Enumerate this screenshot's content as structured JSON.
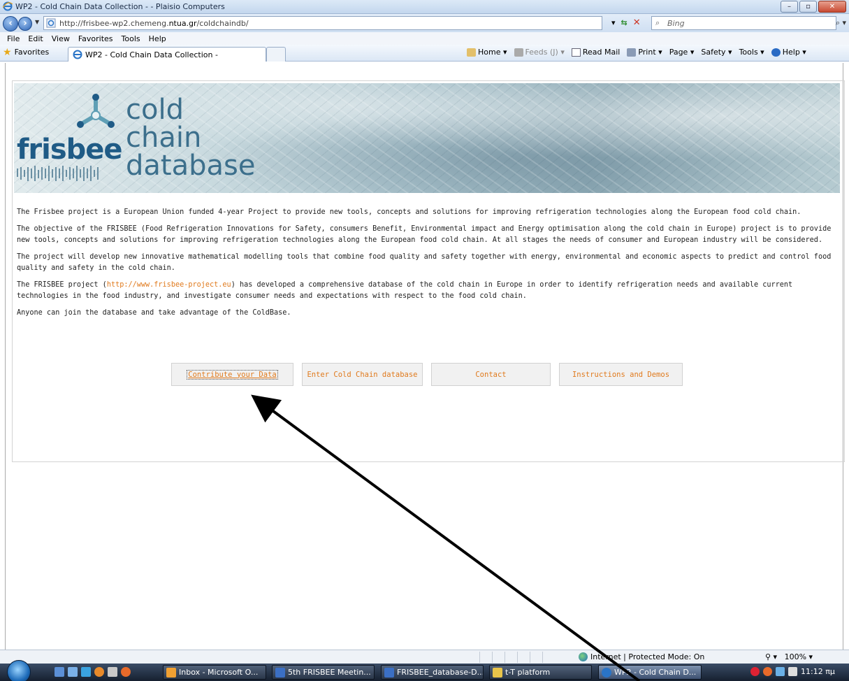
{
  "window": {
    "title": "WP2 - Cold Chain Data Collection - - Plaisio Computers",
    "minimize": "–",
    "maximize": "▫",
    "close": "✕"
  },
  "address_bar": {
    "url_prefix": "http://frisbee-wp2.chemeng.",
    "url_domain": "ntua.gr",
    "url_suffix": "/coldchaindb/",
    "search_placeholder": "Bing"
  },
  "menu": [
    "File",
    "Edit",
    "View",
    "Favorites",
    "Tools",
    "Help"
  ],
  "command_bar": {
    "favorites_label": "Favorites",
    "tab_title": "WP2 - Cold Chain Data Collection -",
    "home": "Home",
    "feeds": "Feeds (J)",
    "read_mail": "Read Mail",
    "print": "Print",
    "page": "Page",
    "safety": "Safety",
    "tools": "Tools",
    "help": "Help"
  },
  "banner": {
    "brand": "frisbee",
    "line1": "cold",
    "line2": "chain",
    "line3": "database"
  },
  "intro": {
    "p1": "The Frisbee project is a European Union funded 4-year Project to provide new tools, concepts and solutions for improving refrigeration technologies along the European food cold chain.",
    "p2": "The objective of the FRISBEE (Food Refrigeration Innovations for Safety, consumers Benefit, Environmental impact and Energy optimisation along the cold chain in Europe) project is to provide new tools, concepts and solutions for improving refrigeration technologies along the European food cold chain. At all stages the needs of consumer and European industry will be considered.",
    "p3": "The project will develop new innovative mathematical modelling tools that combine food quality and safety together with energy, environmental and economic aspects to predict and control food quality and safety in the cold chain.",
    "p4_before": "The FRISBEE project (",
    "p4_link": "http://www.frisbee-project.eu",
    "p4_after": ") has developed a comprehensive database of the cold chain in Europe in order to identify refrigeration needs and available current technologies in the food industry, and investigate consumer needs and expectations with respect to the food cold chain.",
    "p5": "Anyone can join the database and take advantage of the ColdBase."
  },
  "buttons": {
    "contribute": "Contribute your Data",
    "enter": "Enter Cold Chain database",
    "contact": "Contact",
    "instructions": "Instructions and Demos"
  },
  "status_bar": {
    "zone": "Internet | Protected Mode: On",
    "zoom": "100%"
  },
  "taskbar": {
    "tasks": [
      "Inbox - Microsoft O...",
      "5th FRISBEE Meetin...",
      "FRISBEE_database-D...",
      "t-T platform",
      "WP2 - Cold Chain D..."
    ],
    "clock": "11:12 πμ"
  },
  "colors": {
    "link_orange": "#e07a1d",
    "brand_blue": "#1f5b86"
  }
}
